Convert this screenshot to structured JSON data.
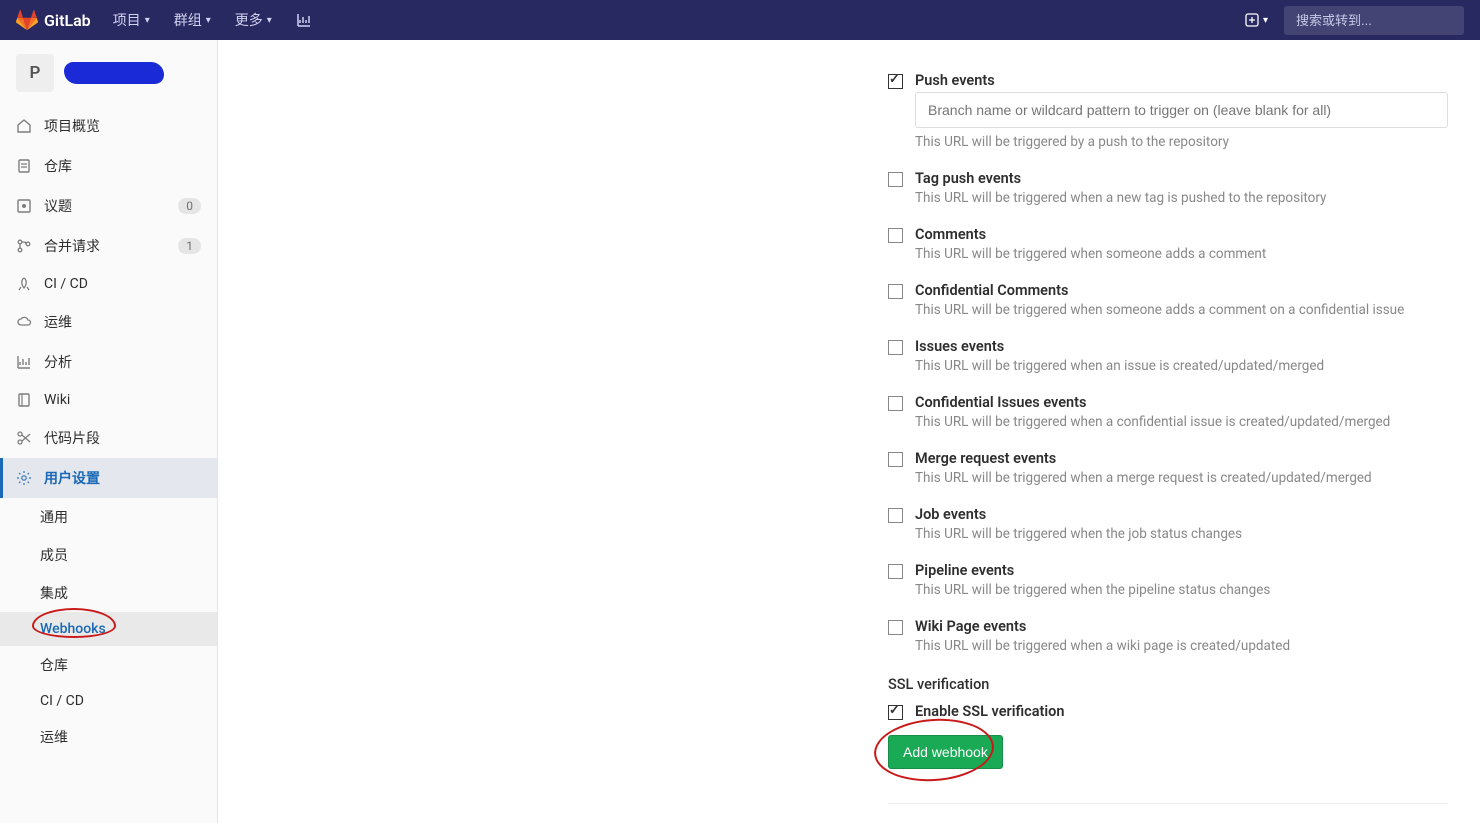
{
  "topbar": {
    "brand": "GitLab",
    "nav": [
      {
        "label": "项目"
      },
      {
        "label": "群组"
      },
      {
        "label": "更多"
      }
    ],
    "search_placeholder": "搜索或转到..."
  },
  "project": {
    "avatar_letter": "P"
  },
  "sidebar": {
    "items": [
      {
        "label": "项目概览",
        "icon": "home"
      },
      {
        "label": "仓库",
        "icon": "file"
      },
      {
        "label": "议题",
        "icon": "issue",
        "badge": "0"
      },
      {
        "label": "合并请求",
        "icon": "merge",
        "badge": "1"
      },
      {
        "label": "CI / CD",
        "icon": "rocket"
      },
      {
        "label": "运维",
        "icon": "cloud"
      },
      {
        "label": "分析",
        "icon": "chart"
      },
      {
        "label": "Wiki",
        "icon": "book"
      },
      {
        "label": "代码片段",
        "icon": "scissors"
      },
      {
        "label": "用户设置",
        "icon": "gear",
        "active": true
      }
    ],
    "sub": [
      {
        "label": "通用"
      },
      {
        "label": "成员"
      },
      {
        "label": "集成"
      },
      {
        "label": "Webhooks",
        "active": true
      },
      {
        "label": "仓库"
      },
      {
        "label": "CI / CD"
      },
      {
        "label": "运维"
      }
    ]
  },
  "form": {
    "triggers": [
      {
        "key": "push",
        "title": "Push events",
        "desc": "This URL will be triggered by a push to the repository",
        "checked": true,
        "has_input": true,
        "placeholder": "Branch name or wildcard pattern to trigger on (leave blank for all)"
      },
      {
        "key": "tag",
        "title": "Tag push events",
        "desc": "This URL will be triggered when a new tag is pushed to the repository",
        "checked": false
      },
      {
        "key": "comments",
        "title": "Comments",
        "desc": "This URL will be triggered when someone adds a comment",
        "checked": false
      },
      {
        "key": "conf_comments",
        "title": "Confidential Comments",
        "desc": "This URL will be triggered when someone adds a comment on a confidential issue",
        "checked": false
      },
      {
        "key": "issues",
        "title": "Issues events",
        "desc": "This URL will be triggered when an issue is created/updated/merged",
        "checked": false
      },
      {
        "key": "conf_issues",
        "title": "Confidential Issues events",
        "desc": "This URL will be triggered when a confidential issue is created/updated/merged",
        "checked": false
      },
      {
        "key": "merge",
        "title": "Merge request events",
        "desc": "This URL will be triggered when a merge request is created/updated/merged",
        "checked": false
      },
      {
        "key": "job",
        "title": "Job events",
        "desc": "This URL will be triggered when the job status changes",
        "checked": false
      },
      {
        "key": "pipeline",
        "title": "Pipeline events",
        "desc": "This URL will be triggered when the pipeline status changes",
        "checked": false
      },
      {
        "key": "wiki",
        "title": "Wiki Page events",
        "desc": "This URL will be triggered when a wiki page is created/updated",
        "checked": false
      }
    ],
    "ssl_section": "SSL verification",
    "ssl_label": "Enable SSL verification",
    "ssl_checked": true,
    "submit": "Add webhook"
  }
}
